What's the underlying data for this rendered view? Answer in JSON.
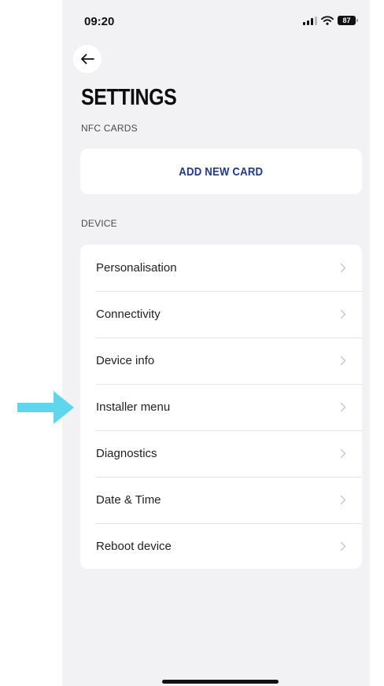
{
  "status_bar": {
    "time": "09:20",
    "battery": "87",
    "icons": [
      "signal-icon",
      "wifi-icon",
      "battery-icon"
    ]
  },
  "header": {
    "back_icon": "arrow-left-icon",
    "title": "SETTINGS"
  },
  "nfc_section": {
    "label": "NFC CARDS",
    "add_button_label": "ADD NEW CARD"
  },
  "device_section": {
    "label": "DEVICE",
    "items": [
      {
        "label": "Personalisation"
      },
      {
        "label": "Connectivity"
      },
      {
        "label": "Device info"
      },
      {
        "label": "Installer menu"
      },
      {
        "label": "Diagnostics"
      },
      {
        "label": "Date & Time"
      },
      {
        "label": "Reboot device"
      }
    ]
  },
  "annotation": {
    "icon": "arrow-right-icon",
    "color": "#5fd6ec"
  },
  "colors": {
    "accent": "#1f3a8a",
    "background": "#f2f2f4",
    "card": "#ffffff"
  }
}
